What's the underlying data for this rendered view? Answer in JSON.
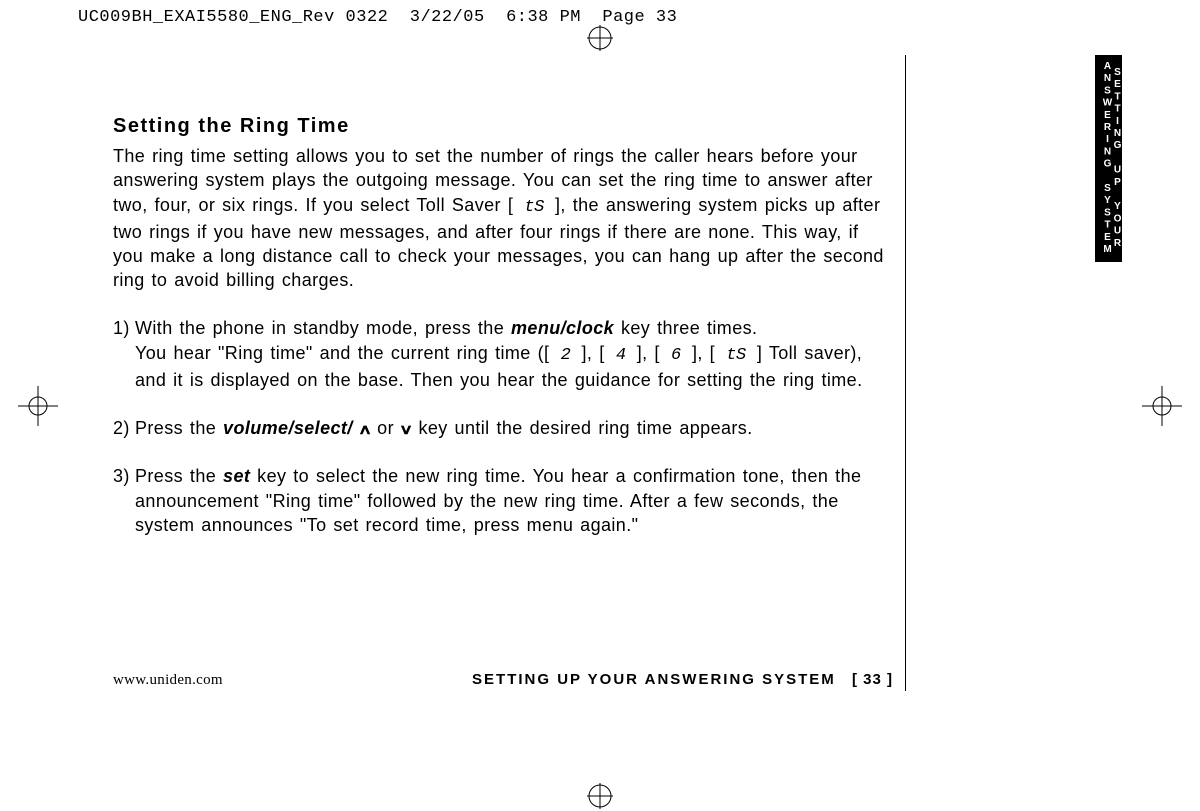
{
  "header": {
    "slug": "UC009BH_EXAI5580_ENG_Rev 0322  3/22/05  6:38 PM  Page 33"
  },
  "tab": {
    "line1": "SETTING UP YOUR",
    "line2": "ANSWERING SYSTEM"
  },
  "content": {
    "title": "Setting the Ring Time",
    "intro_a": "The ring time setting allows you to set the number of rings the caller hears before your answering system plays the outgoing message. You can set the ring time to answer after two, four, or six rings. If you select Toll Saver [",
    "intro_ts": " tS ",
    "intro_b": "], the answering system picks up after two rings if you have new messages, and after four rings if there are none. This way, if you make a long distance call to check your messages, you can hang up after the second ring to avoid billing charges.",
    "step1": {
      "num": "1)",
      "a": "With the phone in standby mode, press the ",
      "key1": "menu/clock",
      "b": " key three times.",
      "c": "You hear \"Ring time\" and the current ring time ([",
      "s2": " 2 ",
      "d": "], [",
      "s4": " 4 ",
      "e": "], [",
      "s6": " 6 ",
      "f": "], [",
      "sts": " tS ",
      "g": "] Toll saver), and it is displayed on the base. Then you hear the guidance for setting the ring time."
    },
    "step2": {
      "num": "2)",
      "a": "Press the ",
      "key1": "volume/select/",
      "b": " or ",
      "c": " key until the desired ring time appears."
    },
    "step3": {
      "num": "3)",
      "a": "Press the ",
      "key1": "set",
      "b": " key to select the new ring time. You hear a confirmation tone, then the announcement \"Ring time\" followed by the new ring time. After a few seconds, the system announces \"To set record time, press menu again.\""
    }
  },
  "footer": {
    "url": "www.uniden.com",
    "section": "SETTING UP YOUR ANSWERING SYSTEM",
    "page": "[ 33 ]"
  }
}
